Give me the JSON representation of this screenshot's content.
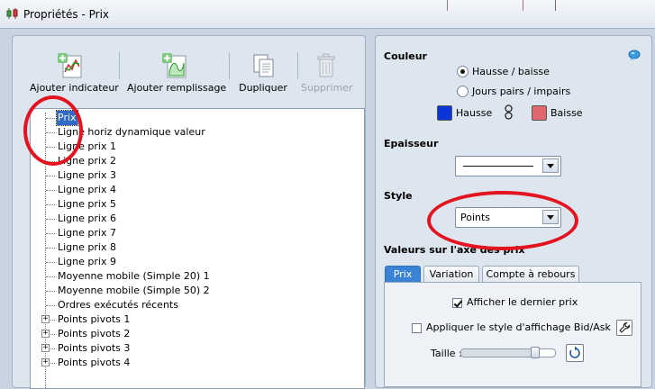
{
  "window": {
    "title": "Propriétés - Prix",
    "app_icon": "chart-candles-icon"
  },
  "toolbar": {
    "buttons": [
      {
        "label": "Ajouter indicateur",
        "icon": "add-indicator-icon",
        "enabled": true
      },
      {
        "label": "Ajouter remplissage",
        "icon": "add-fill-icon",
        "enabled": true
      },
      {
        "label": "Dupliquer",
        "icon": "duplicate-icon",
        "enabled": true
      },
      {
        "label": "Supprimer",
        "icon": "trash-icon",
        "enabled": false
      }
    ]
  },
  "tree": {
    "selected": "Prix",
    "items": [
      {
        "label": "Prix",
        "expandable": false
      },
      {
        "label": "Ligne horiz dynamique valeur",
        "expandable": false
      },
      {
        "label": "Ligne prix 1",
        "expandable": false
      },
      {
        "label": "Ligne prix 2",
        "expandable": false
      },
      {
        "label": "Ligne prix 3",
        "expandable": false
      },
      {
        "label": "Ligne prix 4",
        "expandable": false
      },
      {
        "label": "Ligne prix 5",
        "expandable": false
      },
      {
        "label": "Ligne prix 6",
        "expandable": false
      },
      {
        "label": "Ligne prix 7",
        "expandable": false
      },
      {
        "label": "Ligne prix 8",
        "expandable": false
      },
      {
        "label": "Ligne prix 9",
        "expandable": false
      },
      {
        "label": "Moyenne mobile (Simple 20) 1",
        "expandable": false
      },
      {
        "label": "Moyenne mobile (Simple 50) 2",
        "expandable": false
      },
      {
        "label": "Ordres exécutés récents",
        "expandable": false
      },
      {
        "label": "Points pivots 1",
        "expandable": true
      },
      {
        "label": "Points pivots 2",
        "expandable": true
      },
      {
        "label": "Points pivots 3",
        "expandable": true
      },
      {
        "label": "Points pivots 4",
        "expandable": true
      }
    ]
  },
  "properties": {
    "couleur": {
      "heading": "Couleur",
      "options": [
        "Hausse / baisse",
        "Jours pairs / impairs"
      ],
      "selected_option": "Hausse / baisse",
      "hausse_label": "Hausse",
      "hausse_color": "#0a36d8",
      "baisse_label": "Baisse",
      "baisse_color": "#e0676b",
      "help_icon": "help-bubble-icon",
      "link_icon": "chain-link-icon"
    },
    "epaisseur": {
      "heading": "Epaisseur",
      "selected": "thin-line"
    },
    "style": {
      "heading": "Style",
      "value": "Points"
    },
    "axe": {
      "heading": "Valeurs sur l'axe des prix",
      "tabs": [
        "Prix",
        "Variation",
        "Compte à rebours"
      ],
      "active_tab": "Prix",
      "afficher_dernier_prix": {
        "label": "Afficher le dernier prix",
        "checked": true
      },
      "appliquer_style": {
        "label": "Appliquer le style d'affichage Bid/Ask",
        "checked": false
      },
      "taille_label": "Taille :",
      "taille_level": 0.82,
      "wrench_icon": "wrench-icon",
      "reset_icon": "reset-arrow-icon"
    }
  },
  "accent_colors": {
    "selection": "#3169c6",
    "tab_active": "#3a82d6",
    "annotation": "#e3131f"
  }
}
